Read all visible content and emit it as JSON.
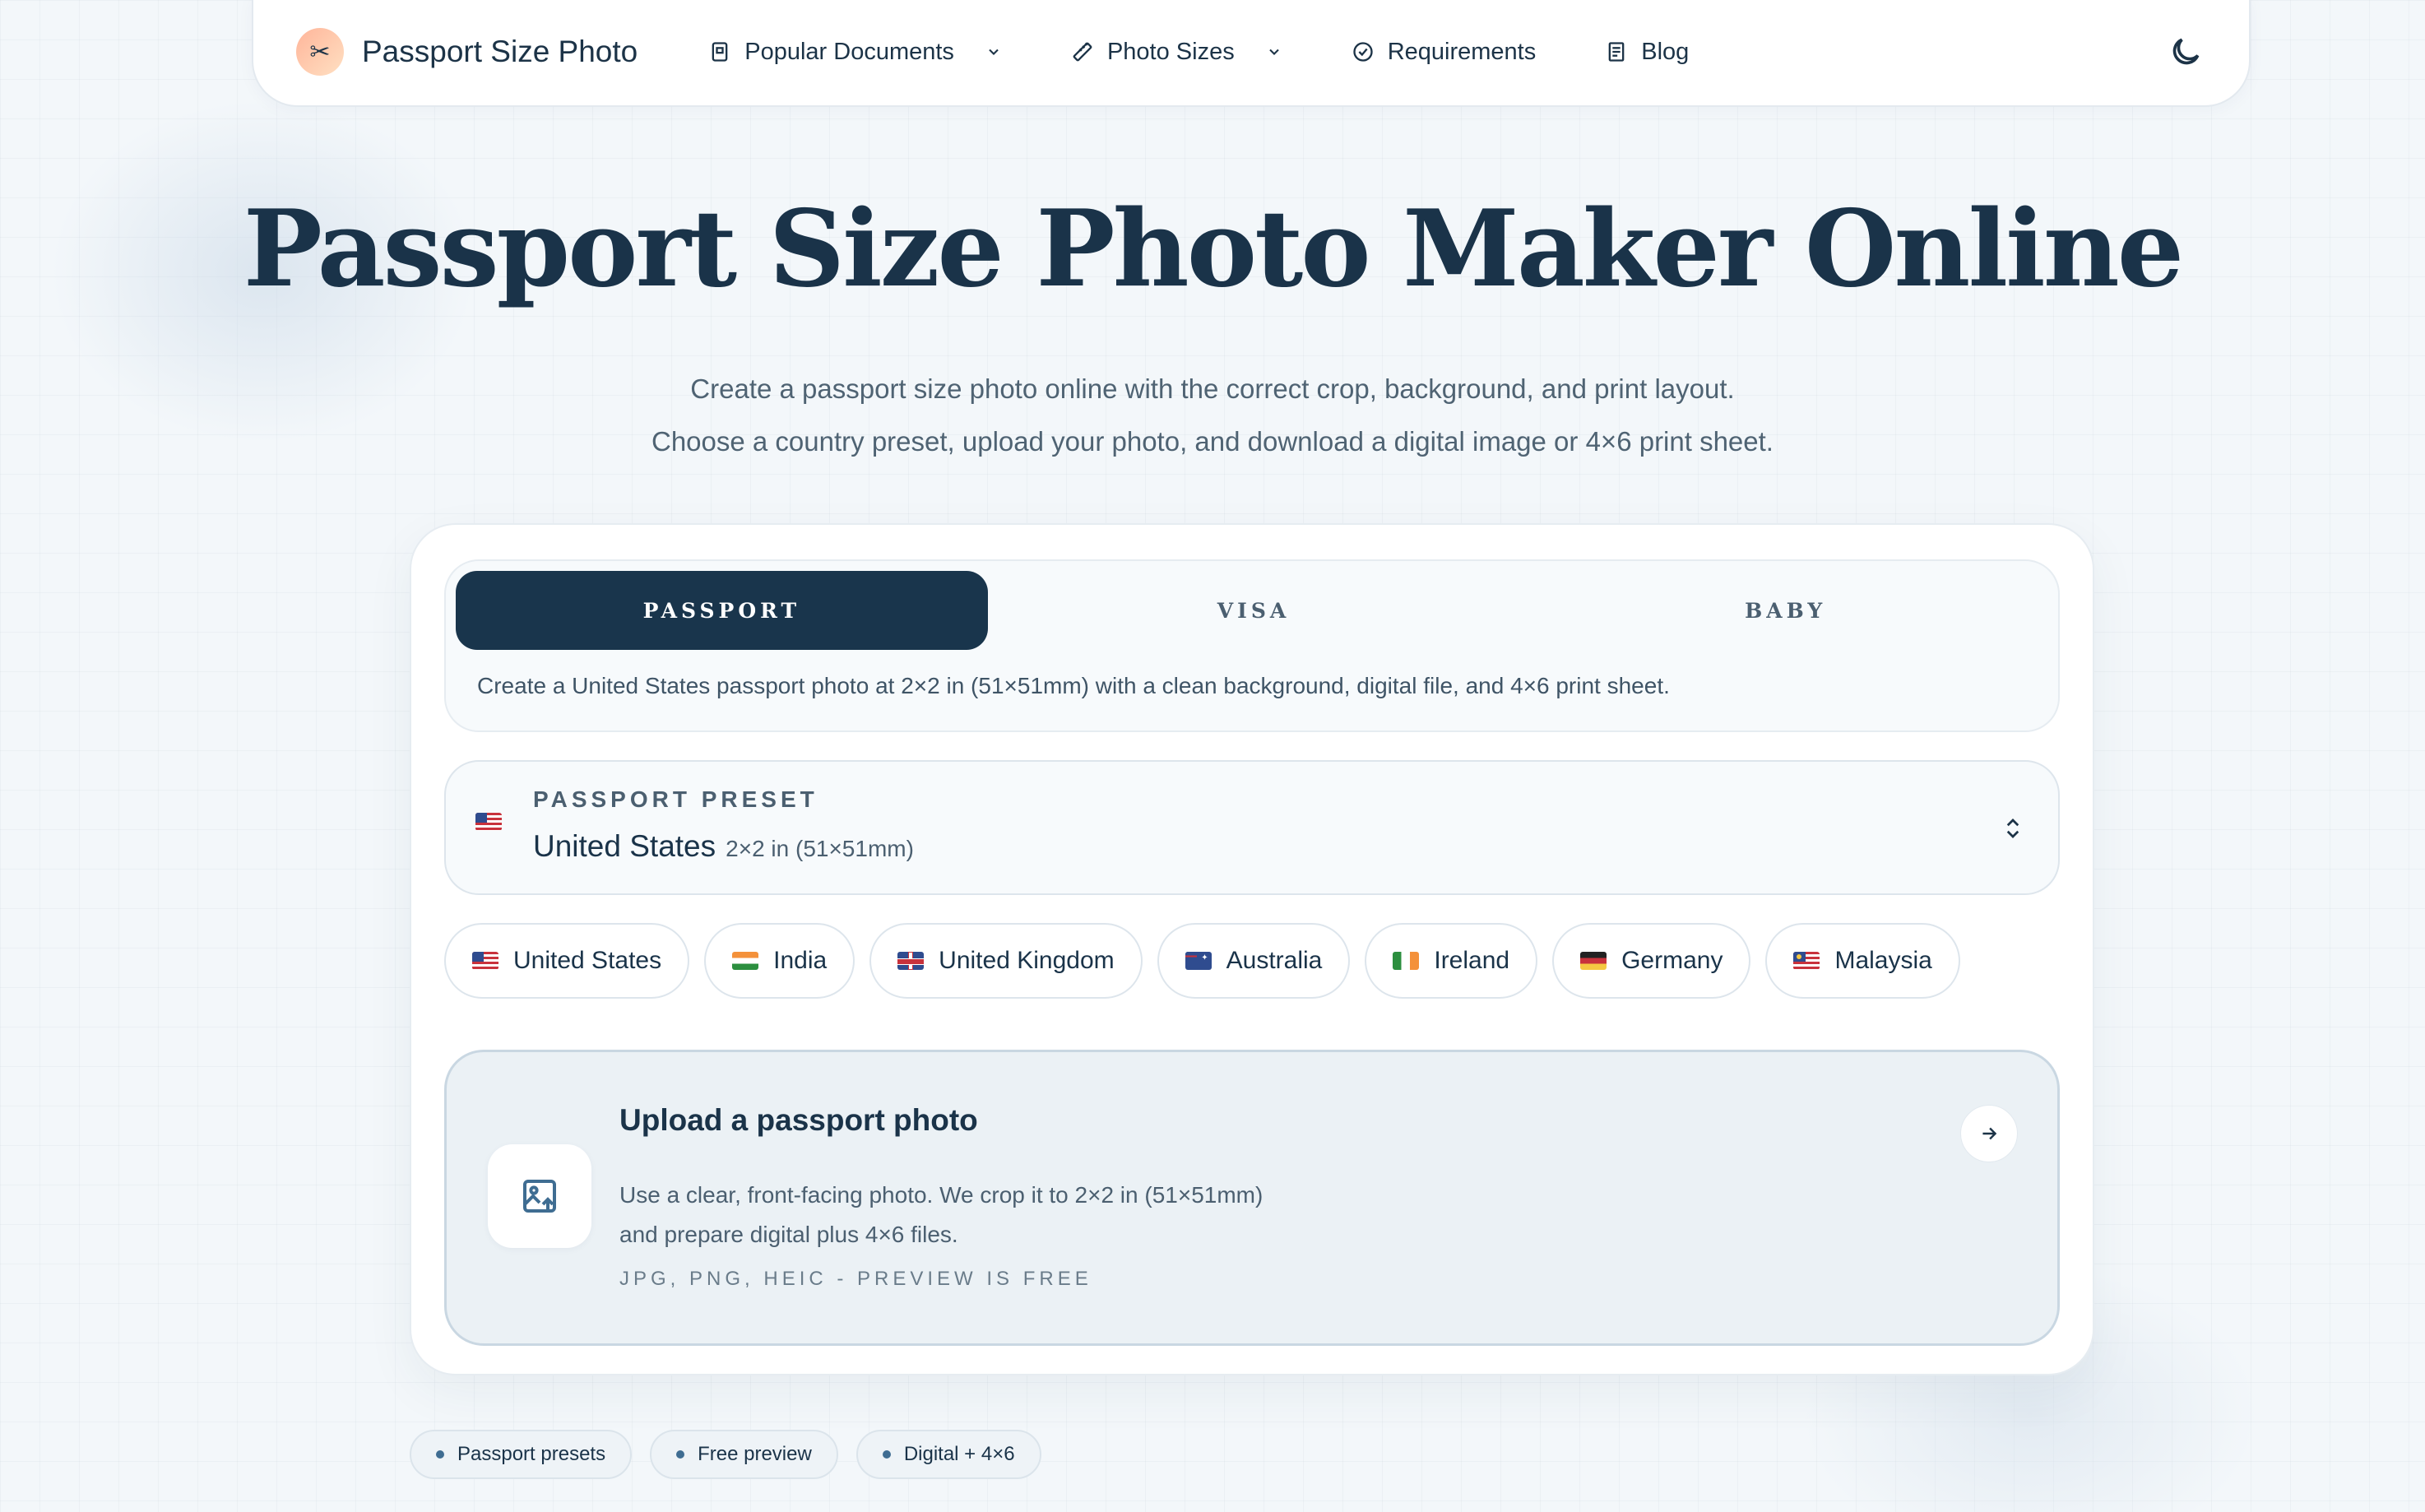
{
  "nav": {
    "brand": "Passport Size Photo",
    "links": [
      {
        "label": "Popular Documents"
      },
      {
        "label": "Photo Sizes"
      },
      {
        "label": "Requirements"
      },
      {
        "label": "Blog"
      }
    ]
  },
  "hero": {
    "title": "Passport Size Photo Maker Online",
    "subtitle_line1": "Create a passport size photo online with the correct crop, background, and print layout.",
    "subtitle_line2": "Choose a country preset, upload your photo, and download a digital image or 4×6 print sheet."
  },
  "tabs": {
    "items": [
      {
        "label": "PASSPORT",
        "active": true
      },
      {
        "label": "VISA",
        "active": false
      },
      {
        "label": "BABY",
        "active": false
      }
    ],
    "description": "Create a United States passport photo at 2×2 in (51×51mm) with a clean background, digital file, and 4×6 print sheet."
  },
  "preset": {
    "label": "PASSPORT PRESET",
    "country": "United States",
    "size": "2×2 in (51×51mm)"
  },
  "countries": [
    {
      "label": "United States",
      "flag": "us"
    },
    {
      "label": "India",
      "flag": "in"
    },
    {
      "label": "United Kingdom",
      "flag": "gb"
    },
    {
      "label": "Australia",
      "flag": "au"
    },
    {
      "label": "Ireland",
      "flag": "ie"
    },
    {
      "label": "Germany",
      "flag": "de"
    },
    {
      "label": "Malaysia",
      "flag": "my"
    }
  ],
  "upload": {
    "title": "Upload a passport photo",
    "desc_line1": "Use a clear, front-facing photo. We crop it to 2×2 in (51×51mm)",
    "desc_line2": "and prepare digital plus 4×6 files.",
    "formats": "JPG, PNG, HEIC - PREVIEW IS FREE"
  },
  "badges": [
    {
      "label": "Passport presets"
    },
    {
      "label": "Free preview"
    },
    {
      "label": "Digital + 4×6"
    }
  ],
  "colors": {
    "primary": "#19354c",
    "text": "#1a3349",
    "muted": "#4b5f70",
    "background": "#f3f7fa"
  },
  "icons": {
    "brand": "scissors-icon",
    "popular_documents": "document-icon",
    "photo_sizes": "ruler-icon",
    "requirements": "check-circle-icon",
    "blog": "article-icon",
    "theme": "moon-icon",
    "upload": "image-upload-icon",
    "upload_arrow": "arrow-right-icon",
    "preset_chevron": "chevron-up-down-icon"
  }
}
